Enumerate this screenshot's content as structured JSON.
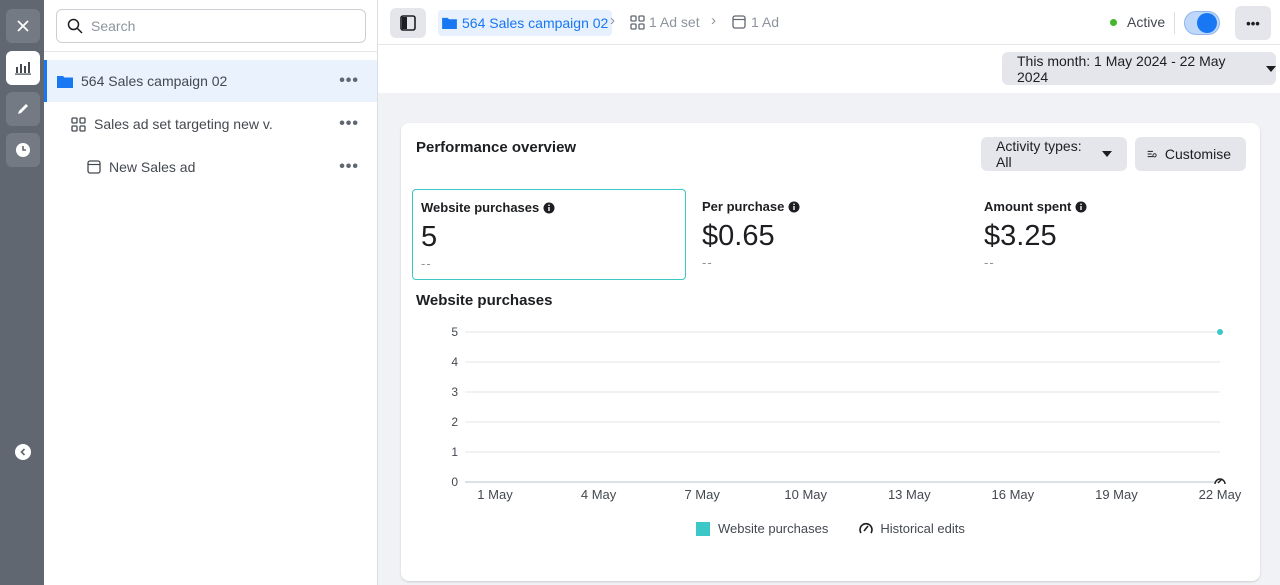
{
  "rail": {
    "items": [
      {
        "icon": "close-icon"
      },
      {
        "icon": "bar-chart-icon"
      },
      {
        "icon": "pencil-icon"
      },
      {
        "icon": "clock-icon"
      }
    ],
    "collapse_icon": "chevron-left-icon"
  },
  "tree": {
    "search_placeholder": "Search",
    "items": [
      {
        "label": "564 Sales campaign 02",
        "icon": "folder-icon",
        "selected": true
      },
      {
        "label": "Sales ad set targeting new v.",
        "icon": "ad-set-icon",
        "selected": false
      },
      {
        "label": "New Sales ad",
        "icon": "ad-icon",
        "selected": false
      }
    ],
    "more_label": "•••"
  },
  "topbar": {
    "breadcrumb": {
      "campaign": "564 Sales campaign 02",
      "ad_set": "1 Ad set",
      "ad": "1 Ad"
    },
    "status": "Active",
    "status_color": "#42b72a",
    "toggle_on": true,
    "more_label": "•••"
  },
  "date_range": {
    "label": "This month: 1 May 2024 - 22 May 2024"
  },
  "card": {
    "title": "Performance overview",
    "activity_filter": "Activity types: All",
    "customise": "Customise",
    "metrics": [
      {
        "label": "Website purchases",
        "value": "5",
        "compare": "--",
        "selected": true
      },
      {
        "label": "Per purchase",
        "value": "$0.65",
        "compare": "--",
        "selected": false
      },
      {
        "label": "Amount spent",
        "value": "$3.25",
        "compare": "--",
        "selected": false
      }
    ],
    "chart_title": "Website purchases"
  },
  "chart_data": {
    "type": "line",
    "title": "Website purchases",
    "xlabel": "",
    "ylabel": "",
    "categories": [
      "1 May",
      "4 May",
      "7 May",
      "10 May",
      "13 May",
      "16 May",
      "19 May",
      "22 May"
    ],
    "yticks": [
      0,
      1,
      2,
      3,
      4,
      5
    ],
    "ylim": [
      0,
      5
    ],
    "series": [
      {
        "name": "Website purchases",
        "color": "#3cc8c8",
        "points": [
          {
            "x": "22 May",
            "y": 5
          }
        ]
      }
    ],
    "legend": [
      {
        "label": "Website purchases",
        "icon": "teal-square"
      },
      {
        "label": "Historical edits",
        "icon": "history-edit-icon"
      }
    ],
    "grid": true,
    "legend_position": "bottom"
  }
}
